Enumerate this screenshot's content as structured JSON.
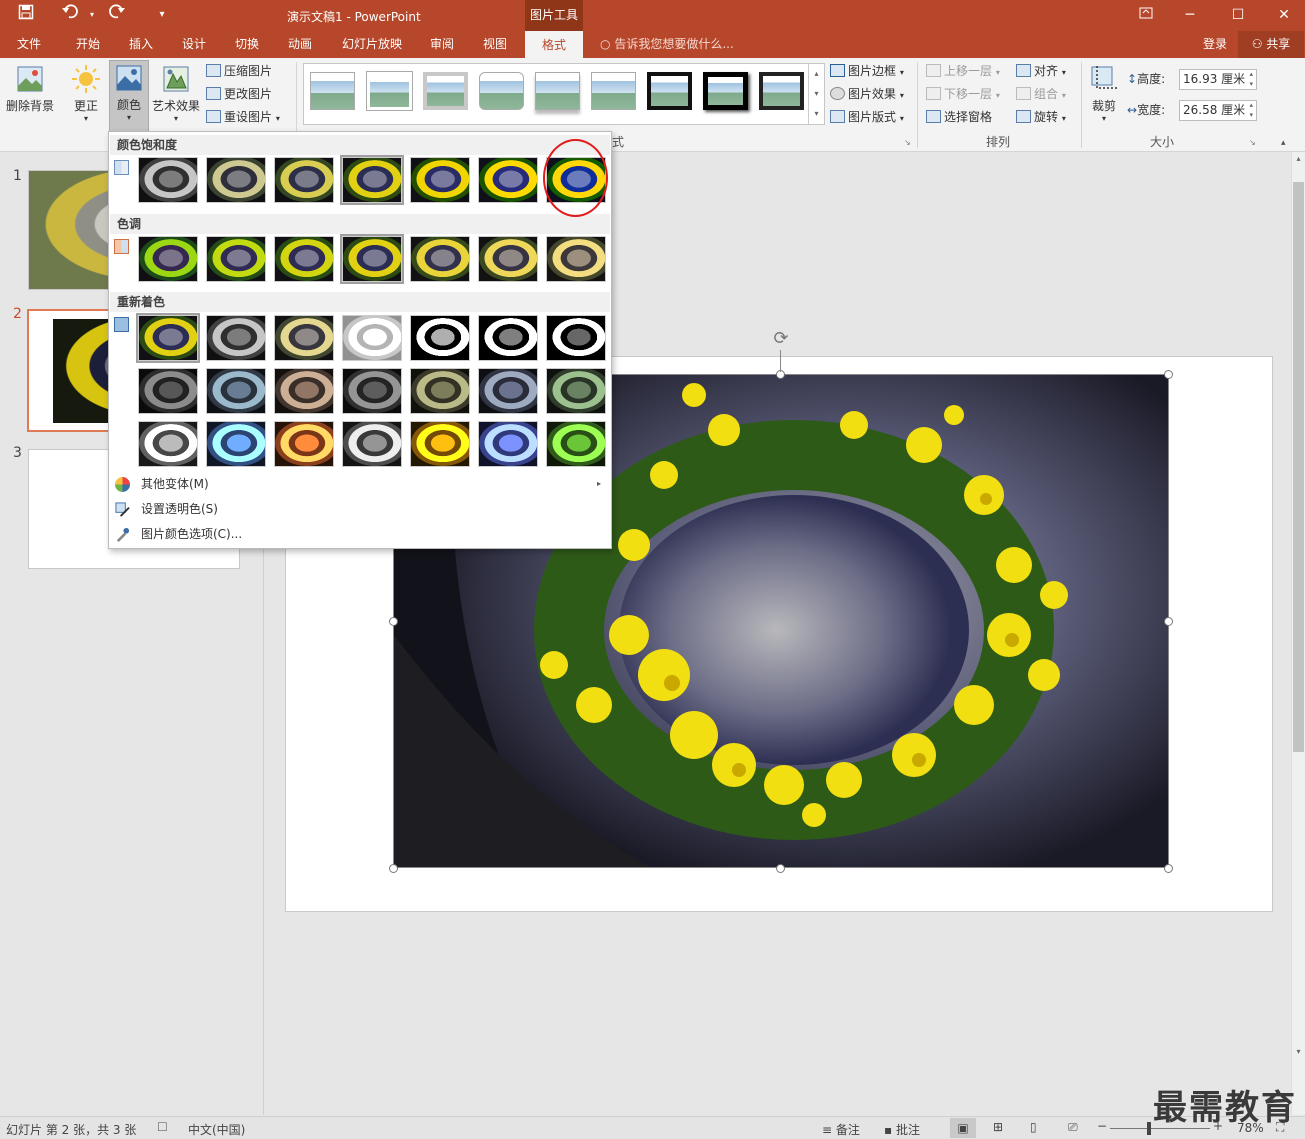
{
  "titlebar": {
    "doc_title": "演示文稿1 - PowerPoint",
    "context_tab": "图片工具",
    "save_icon": "save-icon",
    "undo_icon": "undo-icon",
    "redo_icon": "redo-icon"
  },
  "tabs": [
    "文件",
    "开始",
    "插入",
    "设计",
    "切换",
    "动画",
    "幻灯片放映",
    "审阅",
    "视图",
    "格式"
  ],
  "tellme": "告诉我您想要做什么...",
  "login": "登录",
  "share": "共享",
  "ribbon": {
    "remove_bg": "删除背景",
    "correct": "更正",
    "color": "颜色",
    "art_effect": "艺术效果",
    "compress": "压缩图片",
    "change": "更改图片",
    "reset": "重设图片",
    "style_group_label": "式",
    "border": "图片边框",
    "effect": "图片效果",
    "layout": "图片版式",
    "bring_forward": "上移一层",
    "send_backward": "下移一层",
    "selection_pane": "选择窗格",
    "align": "对齐",
    "group": "组合",
    "rotate": "旋转",
    "arrange_label": "排列",
    "crop": "裁剪",
    "height_label": "高度:",
    "height_value": "16.93 厘米",
    "width_label": "宽度:",
    "width_value": "26.58 厘米",
    "size_label": "大小"
  },
  "dropdown": {
    "saturation_title": "颜色饱和度",
    "tone_title": "色调",
    "recolor_title": "重新着色",
    "more_variants": "其他变体(M)",
    "set_transparent": "设置透明色(S)",
    "color_options": "图片颜色选项(C)..."
  },
  "slides": [
    "1",
    "2",
    "3"
  ],
  "status": {
    "slide_info": "幻灯片 第 2 张，共 3 张",
    "language": "中文(中国)",
    "notes": "备注",
    "comments": "批注",
    "zoom": "78%"
  },
  "watermark": "最需教育",
  "colors": {
    "accent": "#b7472a",
    "accent_dark": "#8f3518",
    "highlight": "#e21b1b"
  }
}
